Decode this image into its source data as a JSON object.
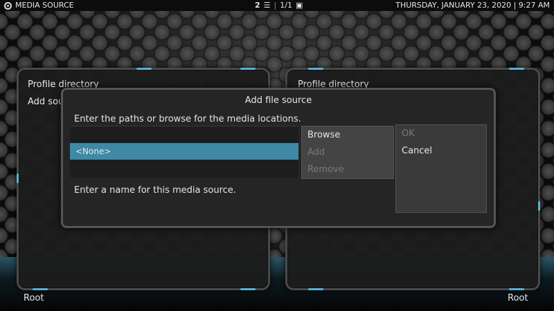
{
  "topbar": {
    "title": "MEDIA SOURCE",
    "view_count": "2",
    "page": "1/1",
    "datetime": "THURSDAY, JANUARY 23, 2020 | 9:27 AM"
  },
  "panels": {
    "left": {
      "heading": "Profile directory",
      "add_label": "Add sou",
      "root_label": "Root"
    },
    "right": {
      "heading": "Profile directory",
      "root_label": "Root"
    }
  },
  "dialog": {
    "title": "Add file source",
    "paths_hint": "Enter the paths or browse for the media locations.",
    "path_items": [
      "<None>"
    ],
    "browse_label": "Browse",
    "add_label": "Add",
    "remove_label": "Remove",
    "ok_label": "OK",
    "cancel_label": "Cancel",
    "name_hint": "Enter a name for this media source."
  },
  "colors": {
    "accent": "#5ab2d6",
    "selected_row": "#3e8aa6"
  }
}
